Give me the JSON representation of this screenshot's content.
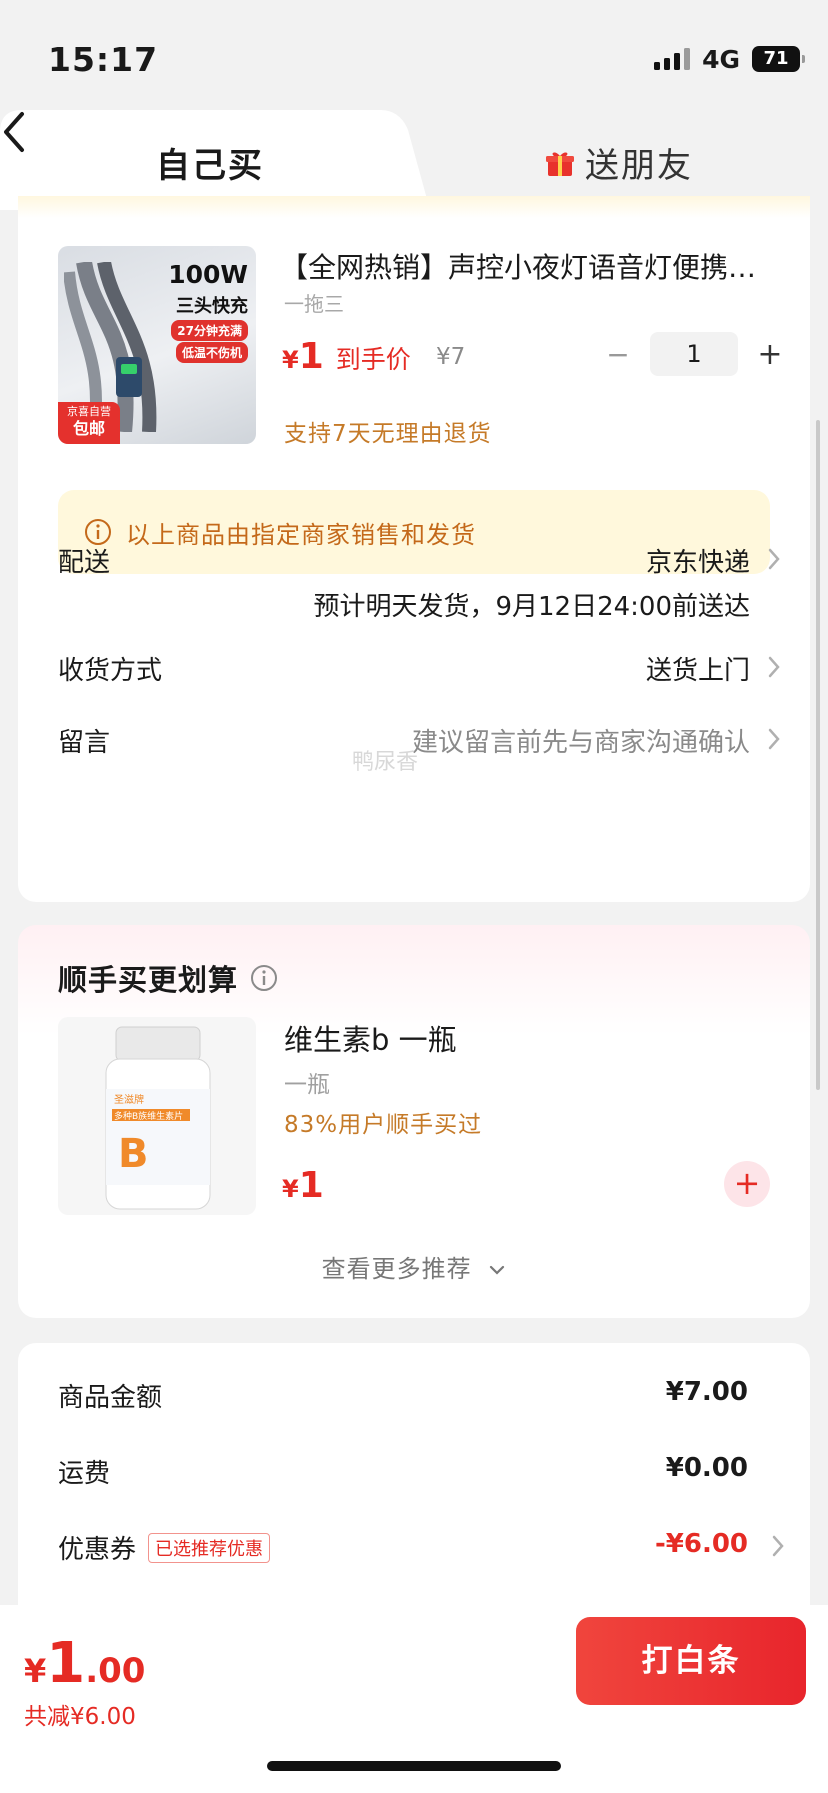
{
  "status_bar": {
    "time": "15:17",
    "network": "4G",
    "battery": "71"
  },
  "tabs": {
    "self_buy": "自己买",
    "gift_friend": "送朋友"
  },
  "product": {
    "image_text": {
      "power": "100W",
      "feature": "三头快充",
      "tag1": "27分钟充满",
      "tag2": "低温不伤机",
      "badge_top": "京喜自营",
      "badge_bottom": "包邮"
    },
    "title": "【全网热销】声控小夜灯语音灯便携…",
    "spec": "一拖三",
    "price_symbol": "¥",
    "price": "1",
    "price_label": "到手价",
    "original_price": "¥7",
    "quantity": "1",
    "qty_minus": "−",
    "qty_plus": "+",
    "return_policy": "支持7天无理由退货"
  },
  "notice": "以上商品由指定商家销售和发货",
  "delivery": {
    "label": "配送",
    "value": "京东快递",
    "estimate": "预计明天发货，9月12日24:00前送达"
  },
  "receive": {
    "label": "收货方式",
    "value": "送货上门"
  },
  "message": {
    "label": "留言",
    "placeholder": "建议留言前先与商家沟通确认"
  },
  "watermark": "鸭尿香",
  "recommend": {
    "title": "顺手买更划算",
    "item_name": "维生素b 一瓶",
    "item_spec": "一瓶",
    "item_stat": "83%用户顺手买过",
    "price_symbol": "¥",
    "price": "1",
    "add": "+",
    "more": "查看更多推荐",
    "bottle_text": {
      "brand": "圣滋牌",
      "name": "多种B族维生素片",
      "letter": "B"
    }
  },
  "summary": {
    "goods_label": "商品金额",
    "goods_value": "¥7.00",
    "shipping_label": "运费",
    "shipping_value": "¥0.00",
    "coupon_label": "优惠券",
    "coupon_tag": "已选推荐优惠",
    "coupon_value": "-¥6.00"
  },
  "footer": {
    "total_symbol": "¥",
    "total_int": "1",
    "total_dec": ".00",
    "saved": "共减¥6.00",
    "pay_button": "打白条"
  },
  "colors": {
    "accent": "#e52b24",
    "notice_bg": "#fff8dc",
    "notice_text": "#c4691a"
  }
}
